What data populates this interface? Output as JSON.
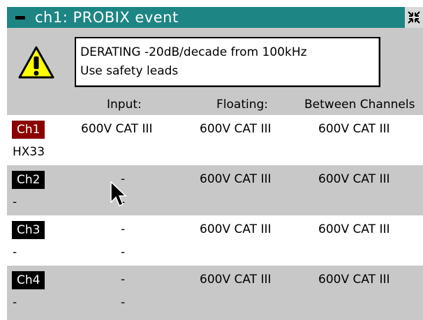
{
  "window": {
    "title": "ch1: PROBIX event",
    "colors": {
      "titlebar": "#1e8585",
      "ch1_badge": "#8b0000",
      "badge": "#000000"
    }
  },
  "message": {
    "line1": "DERATING -20dB/decade from 100kHz",
    "line2": "Use safety leads"
  },
  "columns": {
    "input": "Input:",
    "floating": "Floating:",
    "between": "Between Channels"
  },
  "rows": [
    {
      "channel": "Ch1",
      "input": "600V CAT III",
      "floating": "600V CAT III",
      "between": "600V CAT III",
      "probe": "HX33",
      "probe_input": ""
    },
    {
      "channel": "Ch2",
      "input": "-",
      "floating": "600V CAT III",
      "between": "600V CAT III",
      "probe": "-",
      "probe_input": "-"
    },
    {
      "channel": "Ch3",
      "input": "-",
      "floating": "600V CAT III",
      "between": "600V CAT III",
      "probe": "-",
      "probe_input": "-"
    },
    {
      "channel": "Ch4",
      "input": "-",
      "floating": "600V CAT III",
      "between": "600V CAT III",
      "probe": "-",
      "probe_input": "-"
    }
  ],
  "icons": [
    "minimize-icon",
    "collapse-icon",
    "warning-icon",
    "mouse-cursor-icon"
  ]
}
